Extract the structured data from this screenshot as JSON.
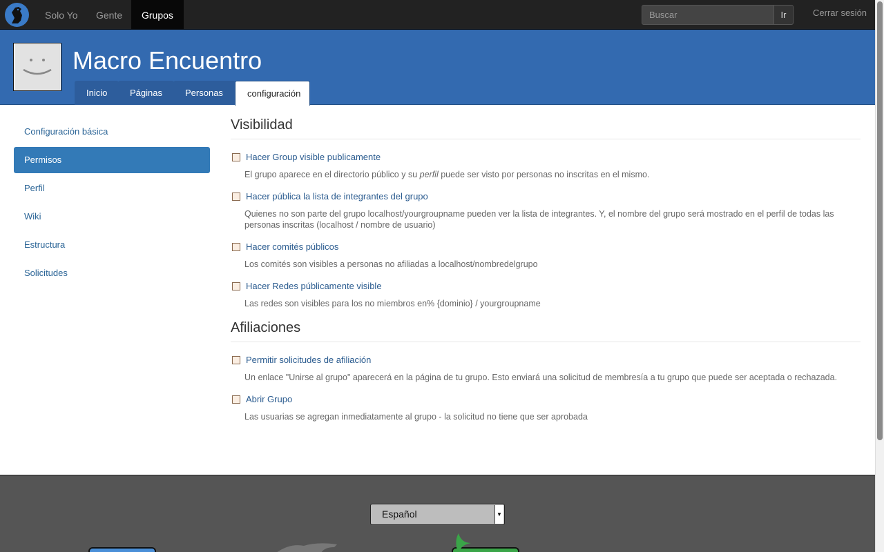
{
  "topnav": {
    "items": [
      {
        "label": "Solo Yo"
      },
      {
        "label": "Gente"
      },
      {
        "label": "Grupos",
        "active": true
      }
    ],
    "search": {
      "placeholder": "Buscar",
      "button": "Ir"
    },
    "logout": "Cerrar sesión"
  },
  "header": {
    "title": "Macro Encuentro",
    "tabs": [
      {
        "label": "Inicio"
      },
      {
        "label": "Páginas"
      },
      {
        "label": "Personas"
      },
      {
        "label": "configuración",
        "active": true
      }
    ]
  },
  "sidebar": {
    "items": [
      {
        "label": "Configuración básica"
      },
      {
        "label": "Permisos",
        "active": true
      },
      {
        "label": "Perfil"
      },
      {
        "label": "Wiki"
      },
      {
        "label": "Estructura"
      },
      {
        "label": "Solicitudes"
      }
    ]
  },
  "visibility": {
    "title": "Visibilidad",
    "options": [
      {
        "label": "Hacer Group visible publicamente",
        "checked": false,
        "desc_before": "El grupo aparece en el directorio público y su ",
        "desc_em": "perfil",
        "desc_after": " puede ser visto por personas no inscritas en el mismo."
      },
      {
        "label": "Hacer pública la lista de integrantes del grupo",
        "checked": false,
        "desc": "Quienes no son parte del grupo localhost/yourgroupname pueden ver la lista de integrantes. Y, el nombre del grupo será mostrado en el perfil de todas las personas inscritas (localhost / nombre de usuario)"
      },
      {
        "label": "Hacer comités públicos",
        "checked": false,
        "desc": "Los comités son visibles a personas no afiliadas a localhost/nombredelgrupo"
      },
      {
        "label": "Hacer Redes públicamente visible",
        "checked": false,
        "desc": "Las redes son visibles para los no miembros en% {dominio} / yourgroupname"
      }
    ]
  },
  "affiliations": {
    "title": "Afiliaciones",
    "options": [
      {
        "label": "Permitir solicitudes de afiliación",
        "checked": false,
        "desc": "Un enlace \"Unirse al grupo\" aparecerá en la página de tu grupo. Esto enviará una solicitud de membresía a tu grupo que puede ser aceptada o rechazada."
      },
      {
        "label": "Abrir Grupo",
        "checked": false,
        "desc": "Las usuarias se agregan inmediatamente al grupo - la solicitud no tiene que ser aprobada"
      }
    ]
  },
  "footer": {
    "language": "Español"
  },
  "colors": {
    "header_bg": "#336ab0",
    "navbar_bg": "#222222",
    "sidebar_active": "#337ab7",
    "link": "#2a6496",
    "footer_bg": "#555555"
  }
}
